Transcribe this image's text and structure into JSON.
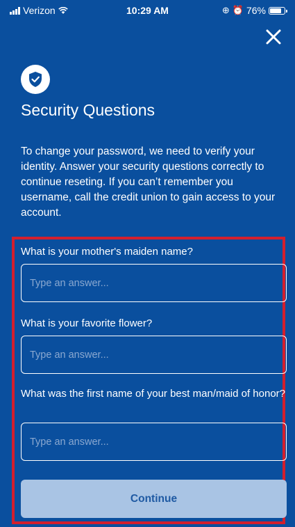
{
  "status_bar": {
    "carrier": "Verizon",
    "time": "10:29 AM",
    "battery": "76%"
  },
  "header": {
    "title": "Security Questions",
    "description": "To change your password, we need to verify your identity. Answer your security questions correctly to continue reseting. If you can’t remember you username, call the credit union to gain access to your account."
  },
  "questions": [
    {
      "label": "What is your mother's maiden name?",
      "placeholder": "Type an answer..."
    },
    {
      "label": "What is your favorite flower?",
      "placeholder": "Type an answer..."
    },
    {
      "label": "What was the first name of your best man/maid of honor?",
      "placeholder": "Type an answer..."
    }
  ],
  "actions": {
    "continue_label": "Continue"
  },
  "colors": {
    "background": "#0a4f9e",
    "highlight_border": "#d21f2e",
    "button_bg": "#a9c4e4",
    "button_text": "#1f5aa3"
  },
  "icons": [
    "signal-icon",
    "wifi-icon",
    "lock-rotation-icon",
    "alarm-icon",
    "battery-icon",
    "close-icon",
    "shield-check-icon"
  ]
}
